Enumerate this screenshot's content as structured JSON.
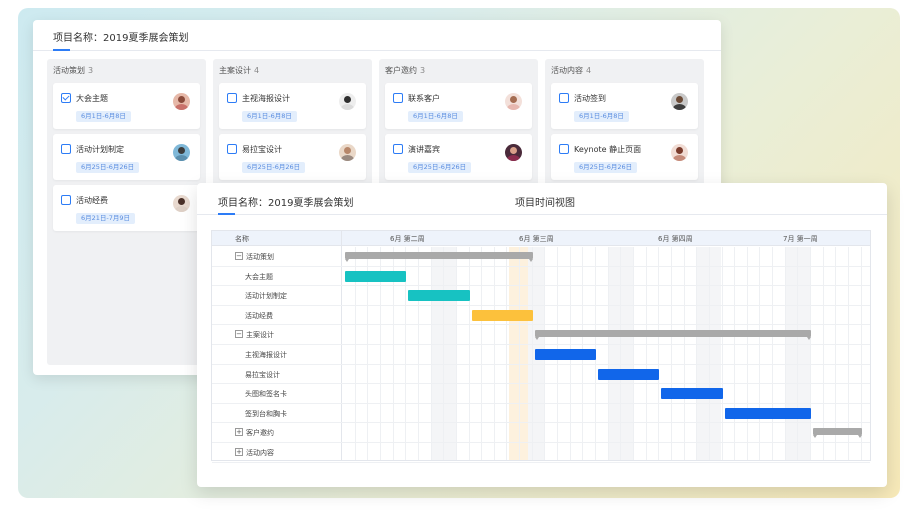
{
  "board": {
    "title": "项目名称：2019夏季展会策划",
    "columns": [
      {
        "name": "活动策划",
        "count": "3",
        "cards": [
          {
            "title": "大会主题",
            "date": "6月1日-6月8日",
            "checked": true
          },
          {
            "title": "活动计划制定",
            "date": "6月25日-6月26日",
            "checked": false
          },
          {
            "title": "活动经费",
            "date": "6月21日-7月9日",
            "checked": false
          }
        ]
      },
      {
        "name": "主案设计",
        "count": "4",
        "cards": [
          {
            "title": "主视海报设计",
            "date": "6月1日-6月8日",
            "checked": false
          },
          {
            "title": "易拉宝设计",
            "date": "6月25日-6月26日",
            "checked": false
          }
        ]
      },
      {
        "name": "客户邀约",
        "count": "3",
        "cards": [
          {
            "title": "联系客户",
            "date": "6月1日-6月8日",
            "checked": false
          },
          {
            "title": "演讲嘉宾",
            "date": "6月25日-6月26日",
            "checked": false
          }
        ]
      },
      {
        "name": "活动内容",
        "count": "4",
        "cards": [
          {
            "title": "活动签到",
            "date": "6月1日-6月8日",
            "checked": false
          },
          {
            "title": "Keynote 静止页面",
            "date": "6月25日-6月26日",
            "checked": false
          }
        ]
      }
    ]
  },
  "gantt": {
    "title": "项目名称：2019夏季展会策划",
    "view_title": "项目时间视图",
    "name_header": "名称",
    "weeks": [
      "6月 第二周",
      "6月 第三周",
      "6月 第四周",
      "7月 第一周"
    ],
    "rows": [
      {
        "label": "活动策划",
        "type": "group",
        "expanded": true,
        "toggle": "−",
        "start": 0,
        "end": 15,
        "color": "#a9a9a9"
      },
      {
        "label": "大会主题",
        "type": "task",
        "start": 0,
        "end": 5,
        "color": "#17c2c2"
      },
      {
        "label": "活动计划制定",
        "type": "task",
        "start": 5,
        "end": 10,
        "color": "#17c2c2"
      },
      {
        "label": "活动经费",
        "type": "task",
        "start": 10,
        "end": 15,
        "color": "#fcc13c"
      },
      {
        "label": "主案设计",
        "type": "group",
        "expanded": true,
        "toggle": "−",
        "start": 15,
        "end": 37,
        "color": "#a9a9a9"
      },
      {
        "label": "主视海报设计",
        "type": "task",
        "start": 15,
        "end": 20,
        "color": "#1166ea"
      },
      {
        "label": "易拉宝设计",
        "type": "task",
        "start": 20,
        "end": 25,
        "color": "#1166ea"
      },
      {
        "label": "头图和签名卡",
        "type": "task",
        "start": 25,
        "end": 30,
        "color": "#1166ea"
      },
      {
        "label": "签到台和胸卡",
        "type": "task",
        "start": 30,
        "end": 37,
        "color": "#1166ea"
      },
      {
        "label": "客户邀约",
        "type": "group",
        "expanded": false,
        "toggle": "+",
        "start": 37,
        "end": 41,
        "color": "#a9a9a9"
      },
      {
        "label": "活动内容",
        "type": "group",
        "expanded": false,
        "toggle": "+",
        "start": null,
        "end": null,
        "color": "#a9a9a9"
      }
    ]
  }
}
